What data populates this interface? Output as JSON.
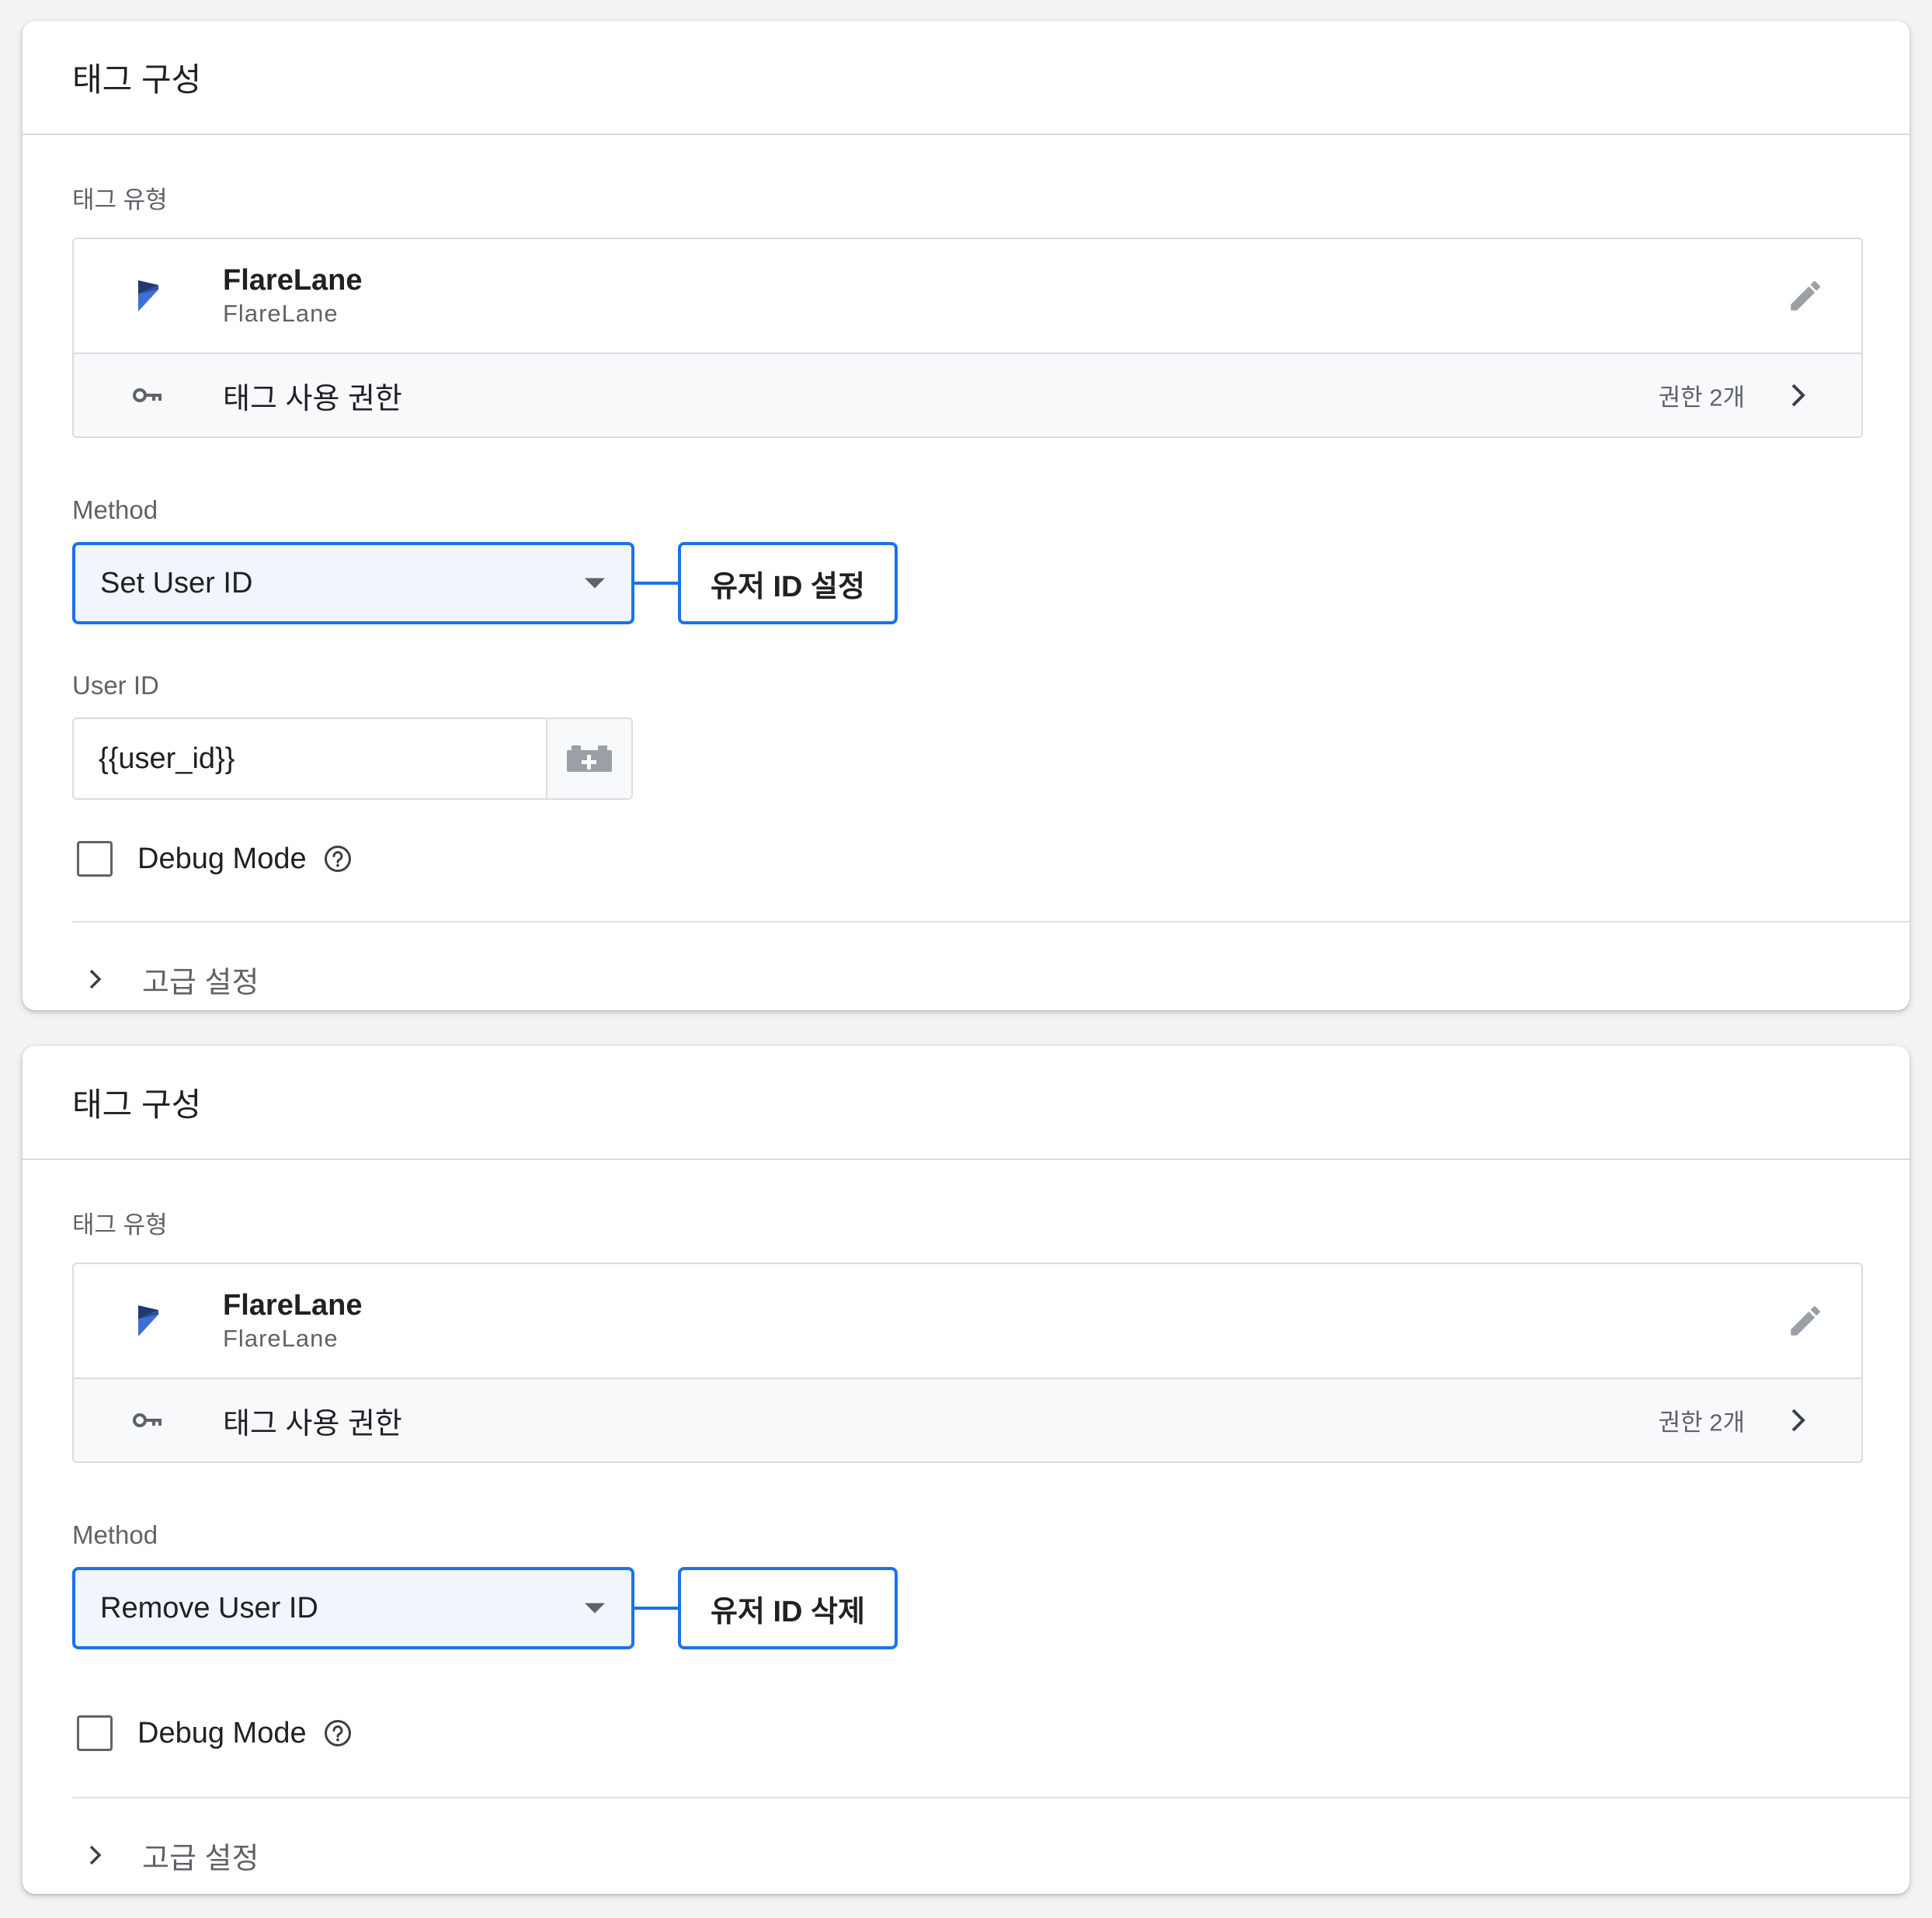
{
  "colors": {
    "accent": "#1a73e8",
    "icon_grey": "#5f6368",
    "logo_dark": "#1f3a6e",
    "logo_light": "#3d6fd9"
  },
  "cards": [
    {
      "title": "태그 구성",
      "tag_type_label": "태그 유형",
      "tag": {
        "name": "FlareLane",
        "vendor": "FlareLane"
      },
      "permissions": {
        "label": "태그 사용 권한",
        "count": "권한 2개"
      },
      "method_label": "Method",
      "method_value": "Set User ID",
      "callout": "유저 ID 설정",
      "user_id_label": "User ID",
      "user_id_value": "{{user_id}}",
      "debug_label": "Debug Mode",
      "advanced_label": "고급 설정"
    },
    {
      "title": "태그 구성",
      "tag_type_label": "태그 유형",
      "tag": {
        "name": "FlareLane",
        "vendor": "FlareLane"
      },
      "permissions": {
        "label": "태그 사용 권한",
        "count": "권한 2개"
      },
      "method_label": "Method",
      "method_value": "Remove User ID",
      "callout": "유저 ID 삭제",
      "debug_label": "Debug Mode",
      "advanced_label": "고급 설정"
    }
  ]
}
